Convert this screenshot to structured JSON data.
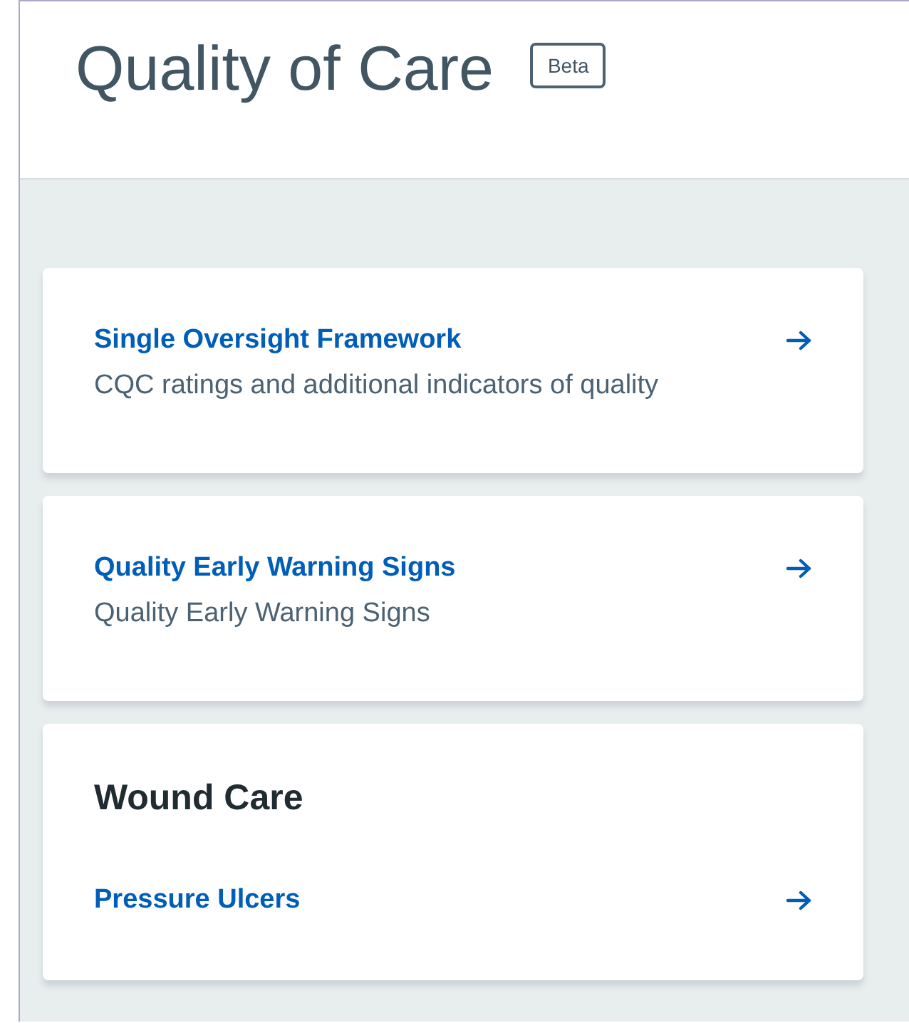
{
  "header": {
    "title": "Quality of Care",
    "badge": "Beta"
  },
  "cards": [
    {
      "kind": "link",
      "title": "Single Oversight Framework",
      "description": "CQC ratings and additional indicators of quality"
    },
    {
      "kind": "link",
      "title": "Quality Early Warning Signs",
      "description": "Quality Early Warning Signs"
    },
    {
      "kind": "section",
      "heading": "Wound Care",
      "links": [
        "Pressure Ulcers"
      ]
    }
  ]
}
